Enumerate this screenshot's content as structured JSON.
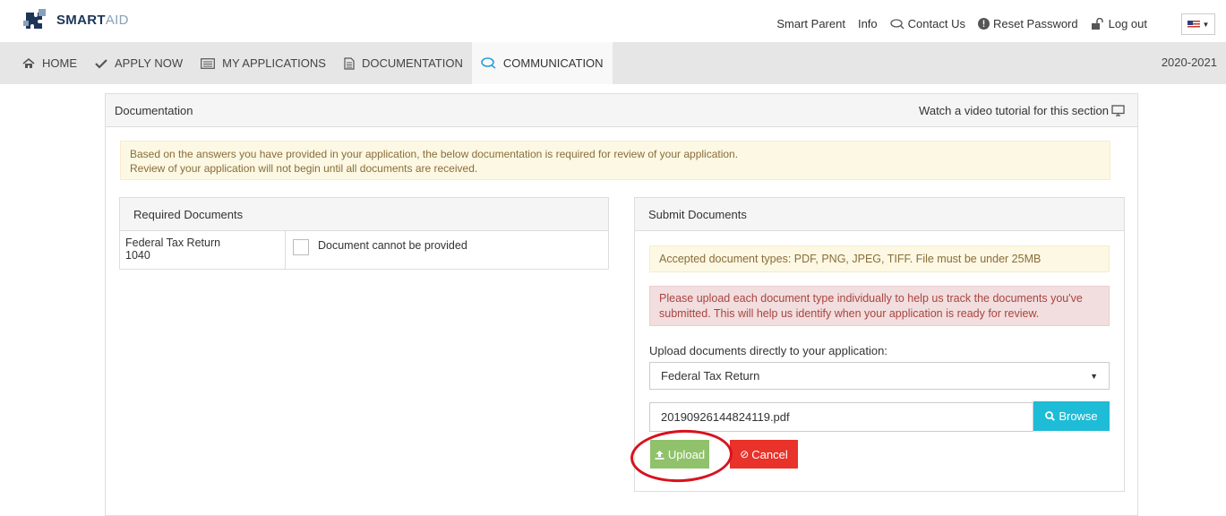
{
  "brand": {
    "bold": "SMART",
    "light": "AID"
  },
  "toplinks": [
    "Smart Parent",
    "Info",
    "Contact Us",
    "Reset Password",
    "Log out"
  ],
  "nav": {
    "items": [
      {
        "label": "HOME",
        "icon": "home-icon"
      },
      {
        "label": "APPLY NOW",
        "icon": "check-icon"
      },
      {
        "label": "MY APPLICATIONS",
        "icon": "list-icon"
      },
      {
        "label": "DOCUMENTATION",
        "icon": "document-icon"
      },
      {
        "label": "COMMUNICATION",
        "icon": "chat-icon",
        "active": true
      }
    ],
    "year": "2020-2021"
  },
  "panel": {
    "title": "Documentation",
    "video_link": "Watch a video tutorial for this section",
    "notice_line1": "Based on the answers you have provided in your application, the below documentation is required for review of your application.",
    "notice_line2": "Review of your application will not begin until all documents are received."
  },
  "required": {
    "title": "Required Documents",
    "doc_name": "Federal Tax Return",
    "doc_code": "1040",
    "cannot_provide": "Document cannot be provided"
  },
  "submit": {
    "title": "Submit Documents",
    "accepted": "Accepted document types: PDF, PNG, JPEG, TIFF. File must be under 25MB",
    "warning": "Please upload each document type individually to help us track the documents you've submitted. This will help us identify when your application is ready for review.",
    "upload_label": "Upload documents directly to your application:",
    "selected_type": "Federal Tax Return",
    "filename": "20190926144824119.pdf",
    "browse": "Browse",
    "upload": "Upload",
    "cancel": "Cancel"
  },
  "colors": {
    "accent": "#2a9fd6",
    "upload": "#8fc26a",
    "cancel": "#e8322a",
    "browse": "#1ebcd6",
    "highlight": "#d8121e"
  }
}
